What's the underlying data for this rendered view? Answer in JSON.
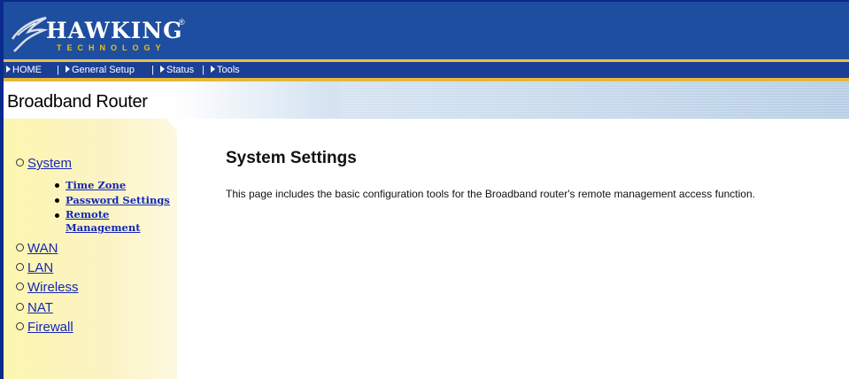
{
  "brand": {
    "name": "HAWKING",
    "tagline": "TECHNOLOGY",
    "trademark": "®",
    "colors": {
      "header": "#1e4ea0",
      "nav": "#1a3f95",
      "gold": "#e8c24a",
      "link": "#1428b4"
    }
  },
  "nav": {
    "items": [
      {
        "label": "HOME",
        "icon": "play-triangle-icon"
      },
      {
        "label": "General Setup",
        "icon": "play-triangle-icon"
      },
      {
        "label": "Status",
        "icon": "play-triangle-icon"
      },
      {
        "label": "Tools",
        "icon": "play-triangle-icon"
      }
    ],
    "separator": "|"
  },
  "subtitle": "Broadband Router",
  "sidebar": {
    "items": [
      {
        "label": "System",
        "icon": "circle-bullet-icon"
      },
      {
        "label": "WAN",
        "icon": "circle-bullet-icon"
      },
      {
        "label": "LAN",
        "icon": "circle-bullet-icon"
      },
      {
        "label": "Wireless",
        "icon": "circle-bullet-icon"
      },
      {
        "label": "NAT",
        "icon": "circle-bullet-icon"
      },
      {
        "label": "Firewall",
        "icon": "circle-bullet-icon"
      }
    ],
    "system_sub": [
      {
        "label": "Time Zone"
      },
      {
        "label": "Password Settings"
      },
      {
        "label": "Remote"
      },
      {
        "label": "Management"
      }
    ]
  },
  "content": {
    "title": "System Settings",
    "description": "This page includes the basic configuration tools for the Broadband router's remote management access function."
  }
}
